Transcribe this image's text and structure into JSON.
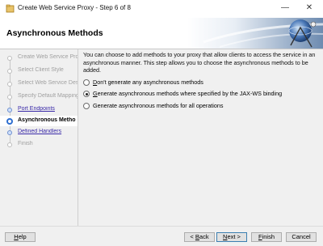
{
  "window": {
    "title": "Create Web Service Proxy - Step 6 of 8",
    "minimize": "—",
    "close": "✕"
  },
  "header": {
    "title": "Asynchronous Methods"
  },
  "steps": [
    {
      "label": "Create Web Service Prox",
      "state": "disabled"
    },
    {
      "label": "Select Client Style",
      "state": "disabled"
    },
    {
      "label": "Select Web Service Desc",
      "state": "disabled"
    },
    {
      "label": "Specify Default Mapping",
      "state": "disabled"
    },
    {
      "label": "Port Endpoints",
      "state": "link"
    },
    {
      "label": "Asynchronous Metho",
      "state": "active"
    },
    {
      "label": "Defined Handlers",
      "state": "link"
    },
    {
      "label": "Finish",
      "state": "disabled"
    }
  ],
  "content": {
    "description": "You can choose to add methods to your proxy that allow clients to access the service in an asynchronous manner. This step allows you to choose the asynchronous methods to be added.",
    "options": [
      {
        "mnemonic": "D",
        "rest": "on't generate any asynchronous methods",
        "checked": false
      },
      {
        "mnemonic": "G",
        "rest": "enerate asynchronous methods where specified by the JAX-WS binding",
        "checked": true
      },
      {
        "mnemonic": "",
        "rest": "Generate asynchronous methods for all operations",
        "checked": false
      }
    ]
  },
  "footer": {
    "help": {
      "mn": "H",
      "rest": "elp"
    },
    "back": {
      "pre": "< ",
      "mn": "B",
      "rest": "ack"
    },
    "next": {
      "mn": "N",
      "rest": "ext >"
    },
    "finish": {
      "mn": "F",
      "rest": "inish"
    },
    "cancel": "Cancel"
  }
}
